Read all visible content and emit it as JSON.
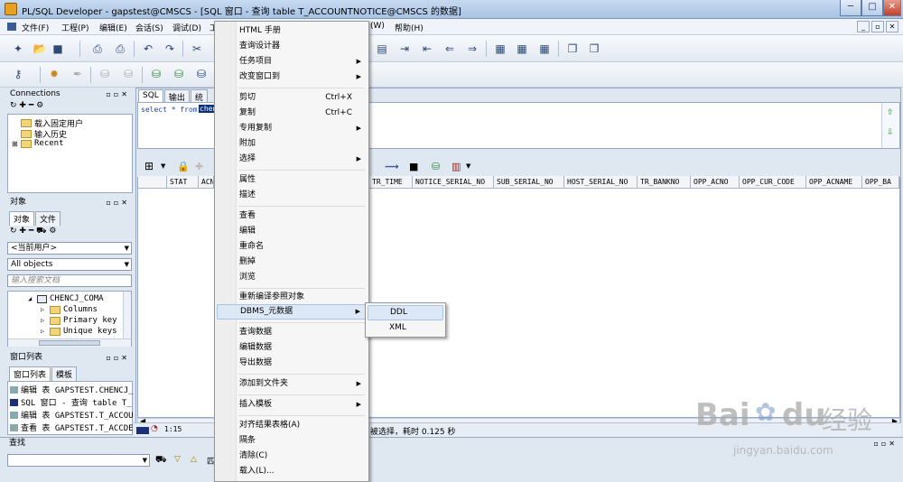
{
  "window": {
    "title": "PL/SQL Developer - gapstest@CMSCS - [SQL 窗口 - 查询 table T_ACCOUNTNOTICE@CMSCS 的数据]",
    "minimize": "─",
    "maximize": "□",
    "close": "✕"
  },
  "menubar": {
    "items": [
      "文件(F)",
      "工程(P)",
      "编辑(E)",
      "会话(S)",
      "调试(D)",
      "工"
    ],
    "right_items": [
      "(W)",
      "帮助(H)"
    ],
    "mdi": [
      "_",
      "▫",
      "✕"
    ]
  },
  "connections": {
    "title": "Connections",
    "items": [
      "载入固定用户",
      "输入历史",
      "Recent"
    ]
  },
  "objects": {
    "title": "对象",
    "tabs": [
      "对象",
      "文件"
    ],
    "user_dropdown": "<当前用户>",
    "filter_dropdown": "All objects",
    "search_placeholder": "输入搜索文档",
    "tree": [
      "CHENCJ_COMA",
      "Columns",
      "Primary key",
      "Unique keys"
    ]
  },
  "window_list": {
    "title": "窗口列表",
    "tabs": [
      "窗口列表",
      "模板"
    ],
    "items": [
      "编辑 表 GAPSTEST.CHENCJ_",
      "SQL 窗口 - 查询 table T_",
      "编辑 表 GAPSTEST.T_ACCOU",
      "查看 表 GAPSTEST.T_ACCDE"
    ]
  },
  "find": {
    "title": "查找",
    "trailing": "匹"
  },
  "editor": {
    "tabs": [
      "SQL",
      "输出",
      "统"
    ],
    "sql_select": "select * from",
    "sql_selected": "chenc"
  },
  "grid": {
    "columns": [
      "STAT",
      "ACN",
      "TR_TIME",
      "NOTICE_SERIAL_NO",
      "SUB_SERIAL_NO",
      "HOST_SERIAL_NO",
      "TR_BANKNO",
      "OPP_ACNO",
      "OPP_CUR_CODE",
      "OPP_ACNAME",
      "OPP_BA"
    ]
  },
  "status": {
    "position": "1:15",
    "message": "被选择，耗时 0.125 秒"
  },
  "context_menu": {
    "items": [
      {
        "label": "HTML 手册"
      },
      {
        "label": "查询设计器"
      },
      {
        "label": "任务项目",
        "submenu": true
      },
      {
        "label": "改变窗口到",
        "submenu": true
      },
      {
        "label": "剪切",
        "shortcut": "Ctrl+X"
      },
      {
        "label": "复制",
        "shortcut": "Ctrl+C"
      },
      {
        "label": "专用复制",
        "submenu": true
      },
      {
        "label": "附加"
      },
      {
        "label": "选择",
        "submenu": true
      },
      {
        "label": "属性"
      },
      {
        "label": "描述"
      },
      {
        "label": "查看"
      },
      {
        "label": "编辑"
      },
      {
        "label": "重命名"
      },
      {
        "label": "删掉"
      },
      {
        "label": "浏览"
      },
      {
        "label": "重新编译参照对象"
      },
      {
        "label": "DBMS_元数据",
        "submenu": true
      },
      {
        "label": "查询数据"
      },
      {
        "label": "编辑数据"
      },
      {
        "label": "导出数据"
      },
      {
        "label": "添加到文件夹",
        "submenu": true
      },
      {
        "label": "插入模板",
        "submenu": true
      },
      {
        "label": "对齐结果表格(A)"
      },
      {
        "label": "隔条"
      },
      {
        "label": "清除(C)"
      },
      {
        "label": "载入(L)..."
      }
    ]
  },
  "submenu": {
    "items": [
      "DDL",
      "XML"
    ]
  },
  "watermark": {
    "brand": "Bai",
    "brand2": "du",
    "cn": "经验",
    "url": "jingyan.baidu.com"
  },
  "colors": {
    "selection": "#0b2f7a",
    "menu_highlight": "#dde8f7",
    "sql_keyword": "#1f3fa8"
  }
}
